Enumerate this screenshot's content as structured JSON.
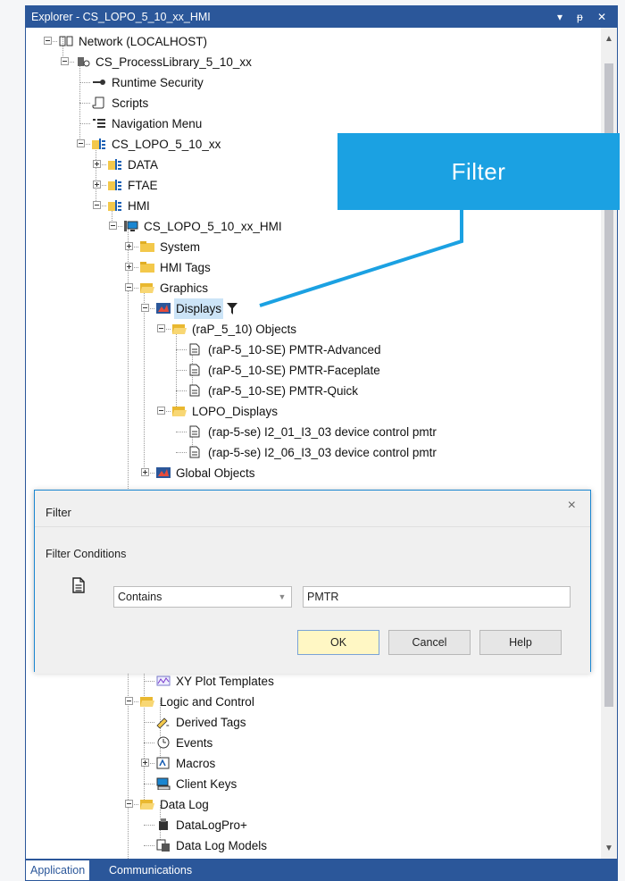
{
  "window": {
    "title": "Explorer - CS_LOPO_5_10_xx_HMI",
    "ctrl_dropdown": "▾",
    "ctrl_pin": "ᵽ",
    "ctrl_close": "✕"
  },
  "tree": [
    {
      "label": "Network (LOCALHOST)",
      "icon": "network-icon"
    },
    {
      "label": "CS_ProcessLibrary_5_10_xx",
      "icon": "application-icon"
    },
    {
      "label": "Runtime Security",
      "icon": "key-icon"
    },
    {
      "label": "Scripts",
      "icon": "script-icon"
    },
    {
      "label": "Navigation Menu",
      "icon": "navigation-menu-icon"
    },
    {
      "label": "CS_LOPO_5_10_xx",
      "icon": "area-icon"
    },
    {
      "label": "DATA",
      "icon": "area-icon"
    },
    {
      "label": "FTAE",
      "icon": "area-icon"
    },
    {
      "label": "HMI",
      "icon": "area-icon"
    },
    {
      "label": "CS_LOPO_5_10_xx_HMI",
      "icon": "hmi-server-icon"
    },
    {
      "label": "System",
      "icon": "folder-icon"
    },
    {
      "label": "HMI Tags",
      "icon": "folder-icon"
    },
    {
      "label": "Graphics",
      "icon": "folder-open-icon"
    },
    {
      "label": "Displays",
      "icon": "displays-icon"
    },
    {
      "label": "(raP_5_10) Objects",
      "icon": "folder-open-icon"
    },
    {
      "label": "(raP-5_10-SE) PMTR-Advanced",
      "icon": "document-icon"
    },
    {
      "label": "(raP-5_10-SE) PMTR-Faceplate",
      "icon": "document-icon"
    },
    {
      "label": "(raP-5_10-SE) PMTR-Quick",
      "icon": "document-icon"
    },
    {
      "label": "LOPO_Displays",
      "icon": "folder-open-icon"
    },
    {
      "label": "(rap-5-se) I2_01_I3_03 device control pmtr",
      "icon": "document-icon"
    },
    {
      "label": "(rap-5-se) I2_06_I3_03 device control pmtr",
      "icon": "document-icon"
    },
    {
      "label": "Global Objects",
      "icon": "displays-icon"
    },
    {
      "label": "XY Plot Templates",
      "icon": "xy-plot-icon"
    },
    {
      "label": "Logic and Control",
      "icon": "folder-open-icon"
    },
    {
      "label": "Derived Tags",
      "icon": "derived-tags-icon"
    },
    {
      "label": "Events",
      "icon": "events-icon"
    },
    {
      "label": "Macros",
      "icon": "macros-icon"
    },
    {
      "label": "Client Keys",
      "icon": "client-keys-icon"
    },
    {
      "label": "Data Log",
      "icon": "folder-open-icon"
    },
    {
      "label": "DataLogPro+",
      "icon": "datalog-icon"
    },
    {
      "label": "Data Log Models",
      "icon": "datalog-models-icon"
    }
  ],
  "tabs": [
    {
      "label": "Application"
    },
    {
      "label": "Communications"
    }
  ],
  "callout": {
    "label": "Filter"
  },
  "dialog": {
    "title": "Filter",
    "close": "×",
    "section_label": "Filter Conditions",
    "condition": "Contains",
    "value": "PMTR",
    "ok_label": "OK",
    "cancel_label": "Cancel",
    "help_label": "Help"
  },
  "colors": {
    "titlebar": "#2b579a",
    "callout": "#1ba1e2",
    "dialog_border": "#1a86d1",
    "ok_button": "#fff7c4"
  }
}
